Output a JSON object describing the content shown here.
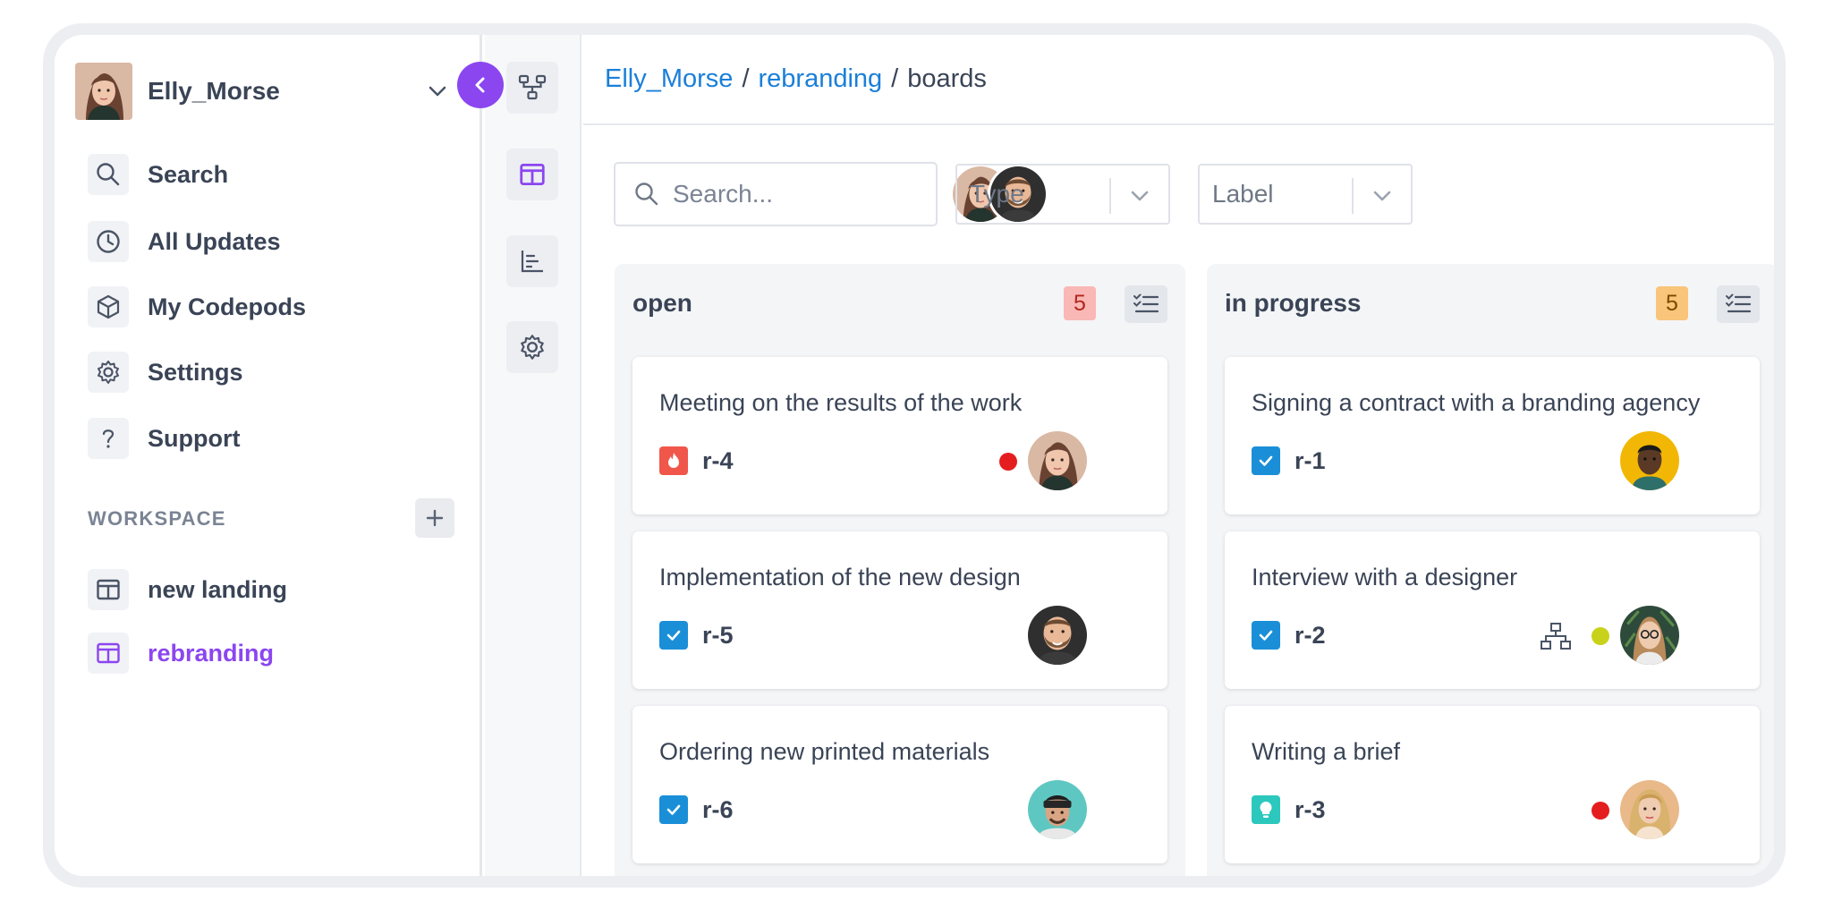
{
  "user": {
    "name": "Elly_Morse"
  },
  "nav": [
    {
      "label": "Search",
      "icon": "search-icon"
    },
    {
      "label": "All Updates",
      "icon": "clock-icon"
    },
    {
      "label": "My Codepods",
      "icon": "cube-icon"
    },
    {
      "label": "Settings",
      "icon": "gear-icon"
    },
    {
      "label": "Support",
      "icon": "question-icon"
    }
  ],
  "workspace": {
    "title": "WORKSPACE",
    "items": [
      {
        "label": "new landing",
        "active": false
      },
      {
        "label": "rebranding",
        "active": true
      }
    ]
  },
  "rail": [
    "hierarchy-icon",
    "board-icon",
    "chart-icon",
    "gear-icon"
  ],
  "breadcrumb": {
    "user": "Elly_Morse",
    "project": "rebranding",
    "sep": "/",
    "current": "boards"
  },
  "toolbar": {
    "search_placeholder": "Search...",
    "type_label": "Type",
    "label_label": "Label"
  },
  "colors": {
    "accent": "#8b46f0",
    "link": "#1a7fd9",
    "open_badge": "#f9b8b5",
    "progress_badge": "#f9c57a"
  },
  "columns": [
    {
      "title": "open",
      "count": "5",
      "cards": [
        {
          "title": "Meeting on the results of the work",
          "key": "r-4",
          "type": "bug",
          "status": "red"
        },
        {
          "title": "Implementation of the new design",
          "key": "r-5",
          "type": "task"
        },
        {
          "title": "Ordering new printed materials",
          "key": "r-6",
          "type": "task"
        }
      ]
    },
    {
      "title": "in progress",
      "count": "5",
      "cards": [
        {
          "title": "Signing a contract with a branding agency",
          "key": "r-1",
          "type": "task"
        },
        {
          "title": "Interview with a designer",
          "key": "r-2",
          "type": "task",
          "status": "yellow",
          "subtasks": true
        },
        {
          "title": "Writing a brief",
          "key": "r-3",
          "type": "idea",
          "status": "red"
        }
      ]
    }
  ]
}
